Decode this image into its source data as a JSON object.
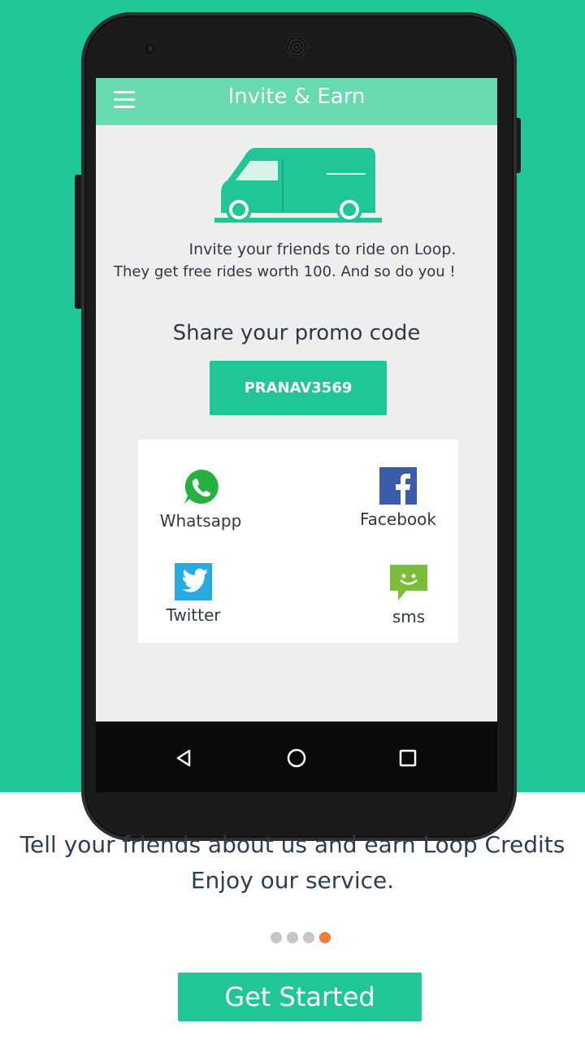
{
  "colors": {
    "accent": "#20c698",
    "appbar": "#67dbad",
    "dot_inactive": "#c6c6c6",
    "dot_active": "#f47b36"
  },
  "appbar": {
    "title": "Invite & Earn",
    "menu_icon": "hamburger-menu-icon"
  },
  "invite": {
    "line1": "Invite your friends to ride on Loop.",
    "line2": "They get free rides worth 100. And so do you !"
  },
  "share": {
    "title": "Share your promo code",
    "promo_code": "PRANAV3569",
    "options": [
      {
        "label": "Whatsapp",
        "icon": "whatsapp-icon"
      },
      {
        "label": "Facebook",
        "icon": "facebook-icon"
      },
      {
        "label": "Twitter",
        "icon": "twitter-icon"
      },
      {
        "label": "sms",
        "icon": "sms-icon"
      }
    ]
  },
  "navbar": {
    "back_icon": "back-icon",
    "home_icon": "home-icon",
    "recents_icon": "recents-icon"
  },
  "onboarding": {
    "line1": "Tell your friends about us and earn Loop Credits",
    "line2": "Enjoy our service.",
    "page_count": 4,
    "current_page": 4,
    "button_label": "Get Started"
  }
}
